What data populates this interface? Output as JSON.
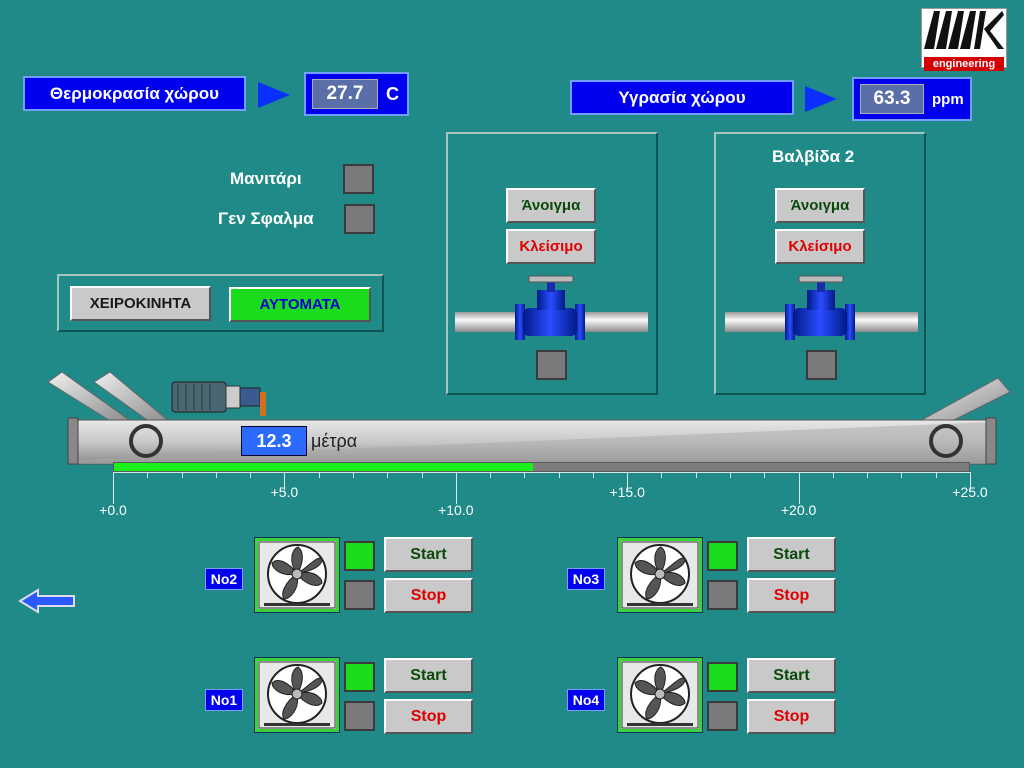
{
  "logo": {
    "mark": "MK",
    "sub": "engineering"
  },
  "temperature": {
    "label": "Θερμοκρασία χώρου",
    "value": "27.7",
    "unit": "C"
  },
  "humidity": {
    "label": "Υγρασία χώρου",
    "value": "63.3",
    "unit": "ppm"
  },
  "status": {
    "mushroom_label": "Μανιτάρι",
    "fault_label": "Γεν Σφαλμα"
  },
  "mode": {
    "manual_label": "ΧΕΙΡΟΚΙΝΗΤΑ",
    "auto_label": "ΑΥΤΟΜΑΤΑ"
  },
  "valve1": {
    "title": "",
    "open_label": "Άνοιγμα",
    "close_label": "Κλείσιμο"
  },
  "valve2": {
    "title": "Βαλβίδα 2",
    "open_label": "Άνοιγμα",
    "close_label": "Κλείσιμο"
  },
  "conveyor": {
    "position_value": "12.3",
    "position_unit": "μέτρα",
    "progress": 0.49
  },
  "scale": {
    "ticks": [
      "+0.0",
      "+5.0",
      "+10.0",
      "+15.0",
      "+20.0",
      "+25.0"
    ]
  },
  "fans": [
    {
      "tag": "No2",
      "start_label": "Start",
      "stop_label": "Stop",
      "running": true
    },
    {
      "tag": "No3",
      "start_label": "Start",
      "stop_label": "Stop",
      "running": true
    },
    {
      "tag": "No1",
      "start_label": "Start",
      "stop_label": "Stop",
      "running": true
    },
    {
      "tag": "No4",
      "start_label": "Start",
      "stop_label": "Stop",
      "running": true
    }
  ],
  "colors": {
    "background": "#1f8a87",
    "accent_blue": "#0000ee",
    "on_green": "#1bdc1b",
    "stop_red": "#e00000"
  },
  "icons": {
    "back": "back-arrow-icon",
    "fan": "fan-icon",
    "valve": "valve-icon",
    "motor": "motor-icon"
  }
}
